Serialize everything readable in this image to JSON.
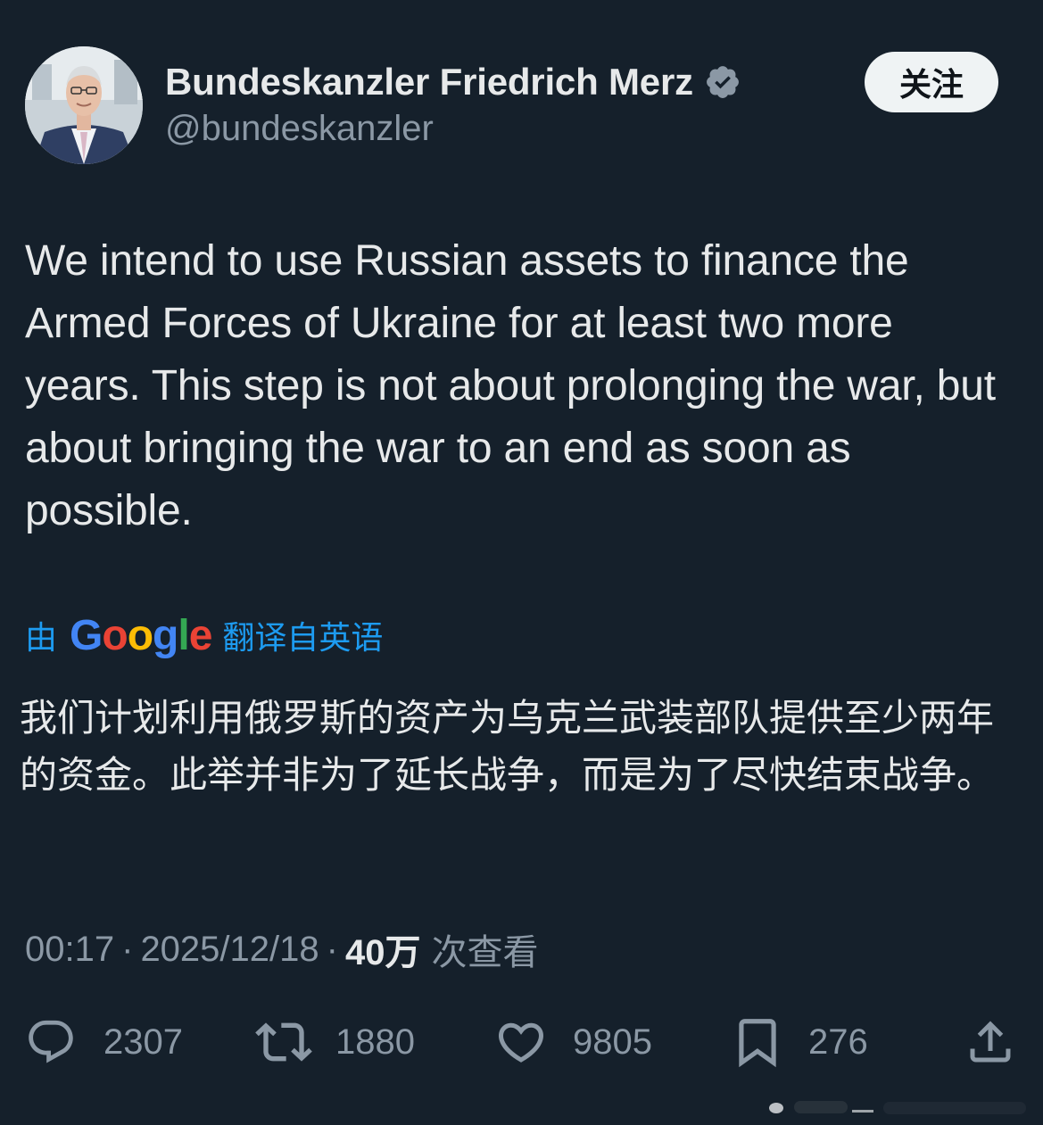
{
  "author": {
    "display_name": "Bundeskanzler Friedrich Merz",
    "handle": "@bundeskanzler",
    "verified_icon": "verified-badge-icon",
    "follow_label": "关注"
  },
  "tweet": {
    "text": "We intend to use Russian assets to finance the Armed Forces of Ukraine for at least two more years. This step is not about prolonging the war, but about bringing the war to an end as soon as possible."
  },
  "translation": {
    "prefix": "由",
    "provider": "Google",
    "suffix": "翻译自英语",
    "text": "我们计划利用俄罗斯的资产为乌克兰武装部队提供至少两年的资金。此举并非为了延长战争，而是为了尽快结束战争。",
    "colors": {
      "link": "#1d9bf0",
      "g_blue": "#4285f4",
      "g_red": "#ea4335",
      "g_yellow": "#fbbc05",
      "g_green": "#34a853"
    }
  },
  "meta": {
    "time": "00:17",
    "separator": "·",
    "date": "2025/12/18",
    "views_count": "40万",
    "views_label": "次查看"
  },
  "actions": {
    "replies": {
      "icon": "reply-icon",
      "count": "2307"
    },
    "reposts": {
      "icon": "repost-icon",
      "count": "1880"
    },
    "likes": {
      "icon": "heart-icon",
      "count": "9805"
    },
    "bookmarks": {
      "icon": "bookmark-icon",
      "count": "276"
    },
    "share": {
      "icon": "share-icon"
    }
  },
  "theme": {
    "background": "#15202b",
    "text": "#e7e9ea",
    "muted": "#8b98a5",
    "verified": "#8b98a5"
  }
}
